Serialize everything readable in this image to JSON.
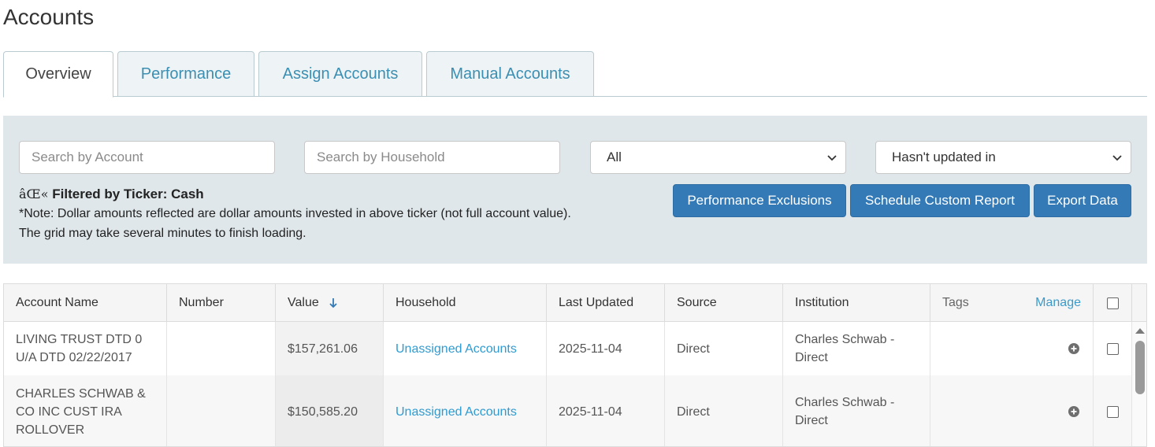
{
  "page": {
    "title": "Accounts"
  },
  "tabs": [
    {
      "label": "Overview",
      "active": true
    },
    {
      "label": "Performance",
      "active": false
    },
    {
      "label": "Assign Accounts",
      "active": false
    },
    {
      "label": "Manual Accounts",
      "active": false
    }
  ],
  "filters": {
    "account_placeholder": "Search by Account",
    "household_placeholder": "Search by Household",
    "type_select": "All",
    "updated_select": "Hasn't updated in"
  },
  "info": {
    "prefix": "âŒ«",
    "filtered": "Filtered by Ticker: Cash",
    "note1": "*Note: Dollar amounts reflected are dollar amounts invested in above ticker (not full account value).",
    "note2": "The grid may take several minutes to finish loading."
  },
  "actions": {
    "exclusions": "Performance Exclusions",
    "schedule": "Schedule Custom Report",
    "export": "Export Data"
  },
  "grid": {
    "headers": {
      "account_name": "Account Name",
      "number": "Number",
      "value": "Value",
      "household": "Household",
      "last_updated": "Last Updated",
      "source": "Source",
      "institution": "Institution",
      "tags": "Tags",
      "manage": "Manage"
    },
    "rows": [
      {
        "name_l1": "LIVING TRUST DTD 0",
        "name_l2": "U/A DTD 02/22/2017",
        "name_l3": "",
        "number": "",
        "value": "$157,261.06",
        "household": "Unassigned Accounts",
        "last_updated": "2025-11-04",
        "source": "Direct",
        "inst_l1": "Charles Schwab -",
        "inst_l2": "Direct"
      },
      {
        "name_l1": "CHARLES SCHWAB &",
        "name_l2": "CO INC CUST IRA",
        "name_l3": "ROLLOVER",
        "number": "",
        "value": "$150,585.20",
        "household": "Unassigned Accounts",
        "last_updated": "2025-11-04",
        "source": "Direct",
        "inst_l1": "Charles Schwab -",
        "inst_l2": "Direct"
      }
    ]
  },
  "colors": {
    "accent": "#337ab7",
    "link": "#2f9bd1",
    "panel": "#dfe7ea"
  },
  "icons": {
    "sort": "arrow-down-icon",
    "add_tag": "plus-circle-icon",
    "select": "chevron-down-icon"
  }
}
